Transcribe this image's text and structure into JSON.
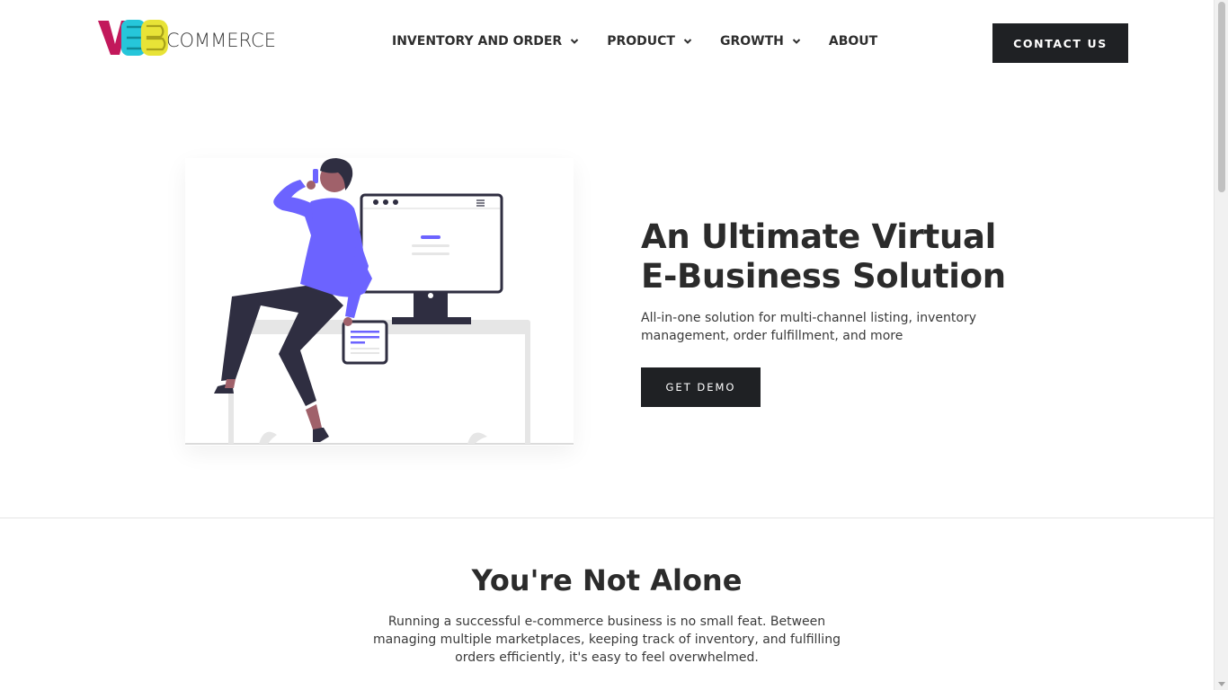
{
  "brand": {
    "logo_word": "COMMERCE",
    "logo_letters": [
      "V",
      "E",
      "B"
    ],
    "colors": {
      "v": "#c2185b",
      "e": "#26c6da",
      "b": "#e8e337"
    }
  },
  "nav": {
    "items": [
      {
        "label": "INVENTORY AND ORDER",
        "has_dropdown": true
      },
      {
        "label": "PRODUCT",
        "has_dropdown": true
      },
      {
        "label": "GROWTH",
        "has_dropdown": true
      },
      {
        "label": "ABOUT",
        "has_dropdown": false
      }
    ],
    "contact_label": "CONTACT US"
  },
  "hero": {
    "title_line1": "An Ultimate Virtual",
    "title_line2": "E-Business Solution",
    "subtitle": "All-in-one solution for multi-channel listing, inventory management, order fulfillment, and more",
    "cta_label": "GET DEMO",
    "illustration_accent": "#6c63ff"
  },
  "section": {
    "title": "You're Not Alone",
    "text": "Running a successful e-commerce business is no small feat. Between managing multiple marketplaces, keeping track of inventory, and fulfilling orders efficiently, it's easy to feel overwhelmed."
  },
  "colors": {
    "button_bg": "#1f2124",
    "text": "#2b2b2b"
  }
}
